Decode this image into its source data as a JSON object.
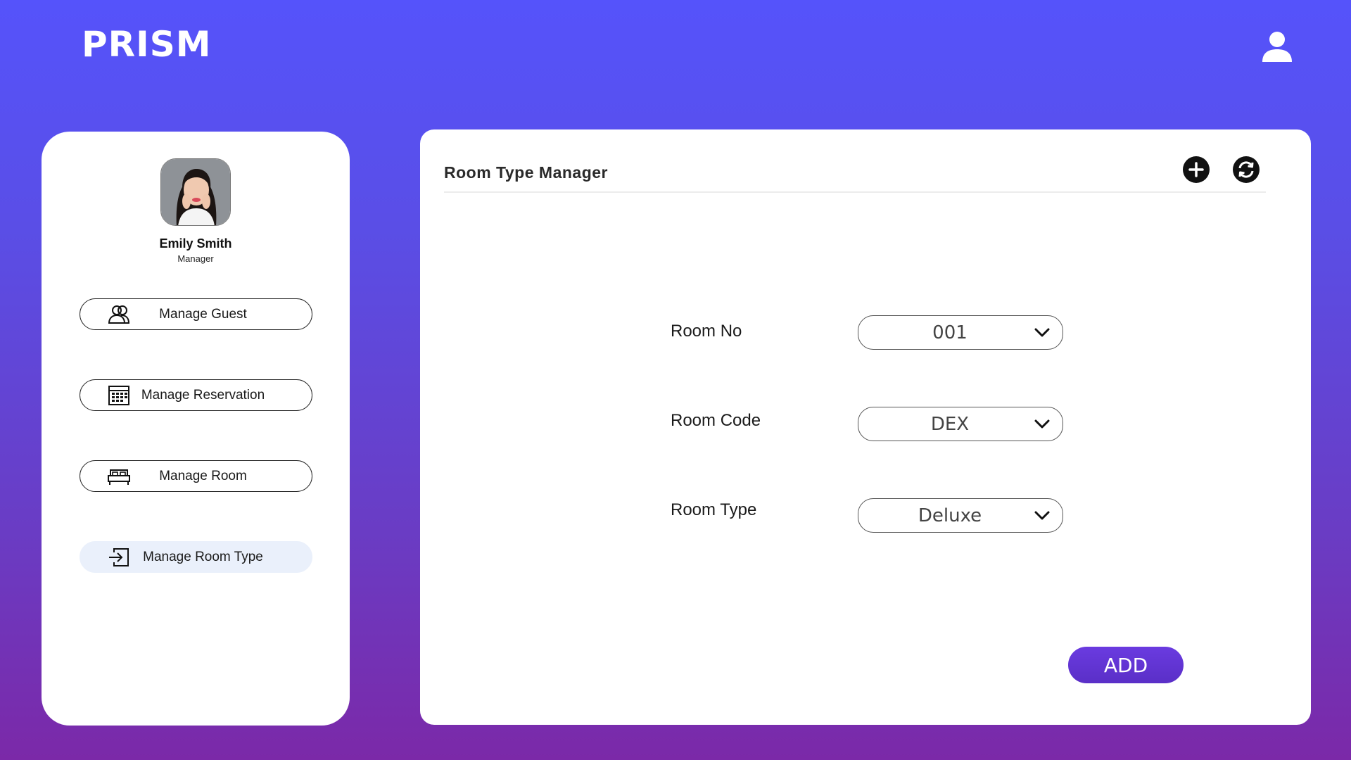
{
  "app": {
    "title": "PRISM"
  },
  "header": {
    "user_icon": "user-icon"
  },
  "profile": {
    "name": "Emily Smith",
    "role": "Manager"
  },
  "sidebar": {
    "items": [
      {
        "label": "Manage Guest",
        "icon": "users-icon",
        "active": false
      },
      {
        "label": "Manage Reservation",
        "icon": "calendar-icon",
        "active": false
      },
      {
        "label": "Manage Room",
        "icon": "bed-icon",
        "active": false
      },
      {
        "label": "Manage Room Type",
        "icon": "sign-in-icon",
        "active": true
      }
    ]
  },
  "main": {
    "title": "Room Type Manager",
    "actions": {
      "add_icon": "plus-circle-icon",
      "refresh_icon": "refresh-icon"
    },
    "form": {
      "room_no": {
        "label": "Room No",
        "value": "001"
      },
      "room_code": {
        "label": "Room Code",
        "value": "DEX"
      },
      "room_type": {
        "label": "Room Type",
        "value": "Deluxe"
      }
    },
    "add_button": "ADD"
  },
  "colors": {
    "background_top": "#5553fb",
    "background_bottom": "#7b29a8",
    "accent": "#6a3be0",
    "active_nav": "#eaf0fb"
  }
}
